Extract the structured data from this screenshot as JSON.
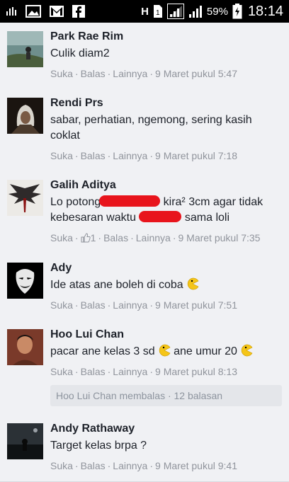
{
  "status_bar": {
    "battery_percent": "59%",
    "time": "18:14",
    "network_label": "H"
  },
  "actions": {
    "like": "Suka",
    "reply": "Balas",
    "more": "Lainnya",
    "sep": "·"
  },
  "comments": [
    {
      "name": "Park Rae Rim",
      "text": "Culik diam2",
      "time": "9 Maret pukul 5:47"
    },
    {
      "name": "Rendi Prs",
      "text1": "sabar, perhatian, ngemong, sering kasih",
      "text2": "coklat",
      "time": "9 Maret pukul 7:18"
    },
    {
      "name": "Galih Aditya",
      "text1a": "Lo potong",
      "text1b": "kira² 3cm agar tidak",
      "text2a": "kebesaran waktu",
      "text2b": "sama loli",
      "like_count": "1",
      "time": "9 Maret pukul 7:35"
    },
    {
      "name": "Ady",
      "text": "Ide atas ane boleh di coba",
      "time": "9 Maret pukul 7:51"
    },
    {
      "name": "Hoo Lui Chan",
      "text_a": "pacar ane kelas 3 sd",
      "text_b": "ane umur 20",
      "time": "9 Maret pukul 8:13",
      "replies": "Hoo Lui Chan membalas · 12 balasan"
    },
    {
      "name": "Andy Rathaway",
      "text": "Target kelas brpa ?",
      "time": "9 Maret pukul 9:41"
    }
  ]
}
